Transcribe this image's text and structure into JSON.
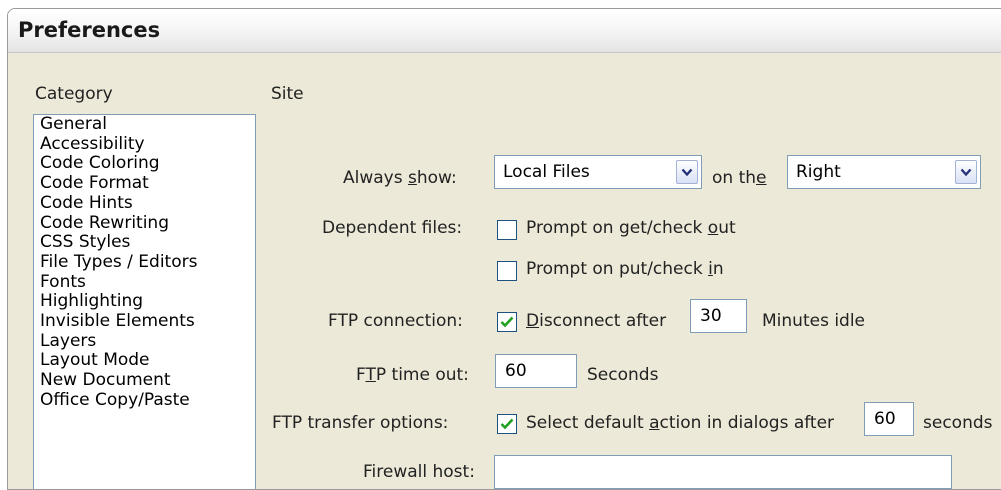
{
  "window": {
    "title": "Preferences"
  },
  "category": {
    "label": "Category",
    "items": [
      "General",
      "Accessibility",
      "Code Coloring",
      "Code Format",
      "Code Hints",
      "Code Rewriting",
      "CSS Styles",
      "File Types / Editors",
      "Fonts",
      "Highlighting",
      "Invisible Elements",
      "Layers",
      "Layout Mode",
      "New Document",
      "Office Copy/Paste"
    ]
  },
  "site": {
    "title": "Site",
    "always_show": {
      "label_pre": "Always ",
      "label_key": "s",
      "label_post": "how:",
      "value": "Local Files",
      "on_pre": "on th",
      "on_key": "e",
      "side_value": "Right"
    },
    "dependent_files": {
      "label": "Dependent files:",
      "get_pre": "Prompt on get/check ",
      "get_key": "o",
      "get_post": "ut",
      "get_checked": false,
      "put_pre": "Prompt on put/check ",
      "put_key": "i",
      "put_post": "n",
      "put_checked": false
    },
    "ftp_connection": {
      "label": "FTP connection:",
      "checked": true,
      "disc_key": "D",
      "disc_post": "isconnect after",
      "minutes": "30",
      "unit": "Minutes idle"
    },
    "ftp_timeout": {
      "label_pre": "F",
      "label_key": "T",
      "label_post": "P time out:",
      "value": "60",
      "unit": "Seconds"
    },
    "ftp_transfer": {
      "label": "FTP transfer options:",
      "checked": true,
      "opt_pre": "Select default ",
      "opt_key": "a",
      "opt_post": "ction in dialogs after",
      "value": "60",
      "unit": "seconds"
    },
    "firewall": {
      "label": "Firewall host:",
      "value": ""
    }
  }
}
